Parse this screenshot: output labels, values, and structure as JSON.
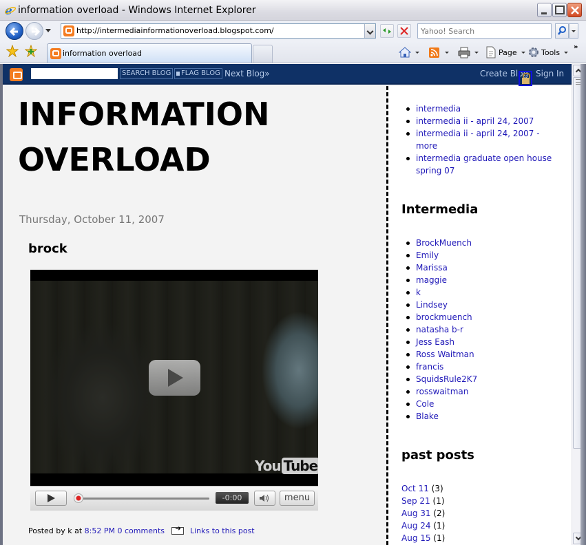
{
  "window": {
    "title": "information overload - Windows Internet Explorer",
    "buttons": {
      "minimize": "minimize",
      "maximize": "maximize",
      "close": "close"
    }
  },
  "addressbar": {
    "url": "http://intermediainformationoverload.blogspot.com/",
    "search_placeholder": "Yahoo! Search"
  },
  "tabs": [
    {
      "label": "information overload",
      "active": true
    }
  ],
  "commandbar": {
    "home": "home-icon",
    "feeds": "feeds-icon",
    "print": "print-icon",
    "page_label": "Page",
    "tools_label": "Tools",
    "more": "»"
  },
  "blogger_nav": {
    "search_button": "SEARCH BLOG",
    "flag_button": "FLAG BLOG",
    "next_blog": "Next Blog»",
    "create_blog": "Create Blog",
    "sign_in": "Sign In"
  },
  "blog": {
    "title_line1": "INFORMATION",
    "title_line2": "OVERLOAD",
    "date_header": "Thursday, October 11, 2007",
    "post": {
      "title": "brock",
      "video": {
        "brand_you": "You",
        "brand_tube": "Tube",
        "time": "-0:00",
        "volume_icon": "volume-icon",
        "menu_label": "menu",
        "progress": 0
      },
      "footer": {
        "posted_by_prefix": "Posted by k at",
        "time": "8:52 PM",
        "comments": "0 comments",
        "links_label": "Links to this post"
      }
    }
  },
  "sidebar": {
    "links": [
      "intermedia",
      "intermedia ii - april 24, 2007",
      "intermedia ii - april 24, 2007 - more",
      "intermedia graduate open house spring 07"
    ],
    "intermedia_heading": "Intermedia",
    "members": [
      "BrockMuench",
      "Emily",
      "Marissa",
      "maggie",
      "k",
      "Lindsey",
      "brockmuench",
      "natasha b-r",
      "Jess Eash",
      "Ross Waitman",
      "francis",
      "SquidsRule2K7",
      "rosswaitman",
      "Cole",
      "Blake"
    ],
    "past_heading": "past posts",
    "archive": [
      {
        "label": "Oct 11",
        "count": "(3)"
      },
      {
        "label": "Sep 21",
        "count": "(1)"
      },
      {
        "label": "Aug 31",
        "count": "(2)"
      },
      {
        "label": "Aug 24",
        "count": "(1)"
      },
      {
        "label": "Aug 15",
        "count": "(1)"
      }
    ]
  },
  "colors": {
    "link": "#2019b8",
    "navbar": "#0f3166",
    "navbar_text": "#b7cbe9",
    "date": "#777777"
  }
}
